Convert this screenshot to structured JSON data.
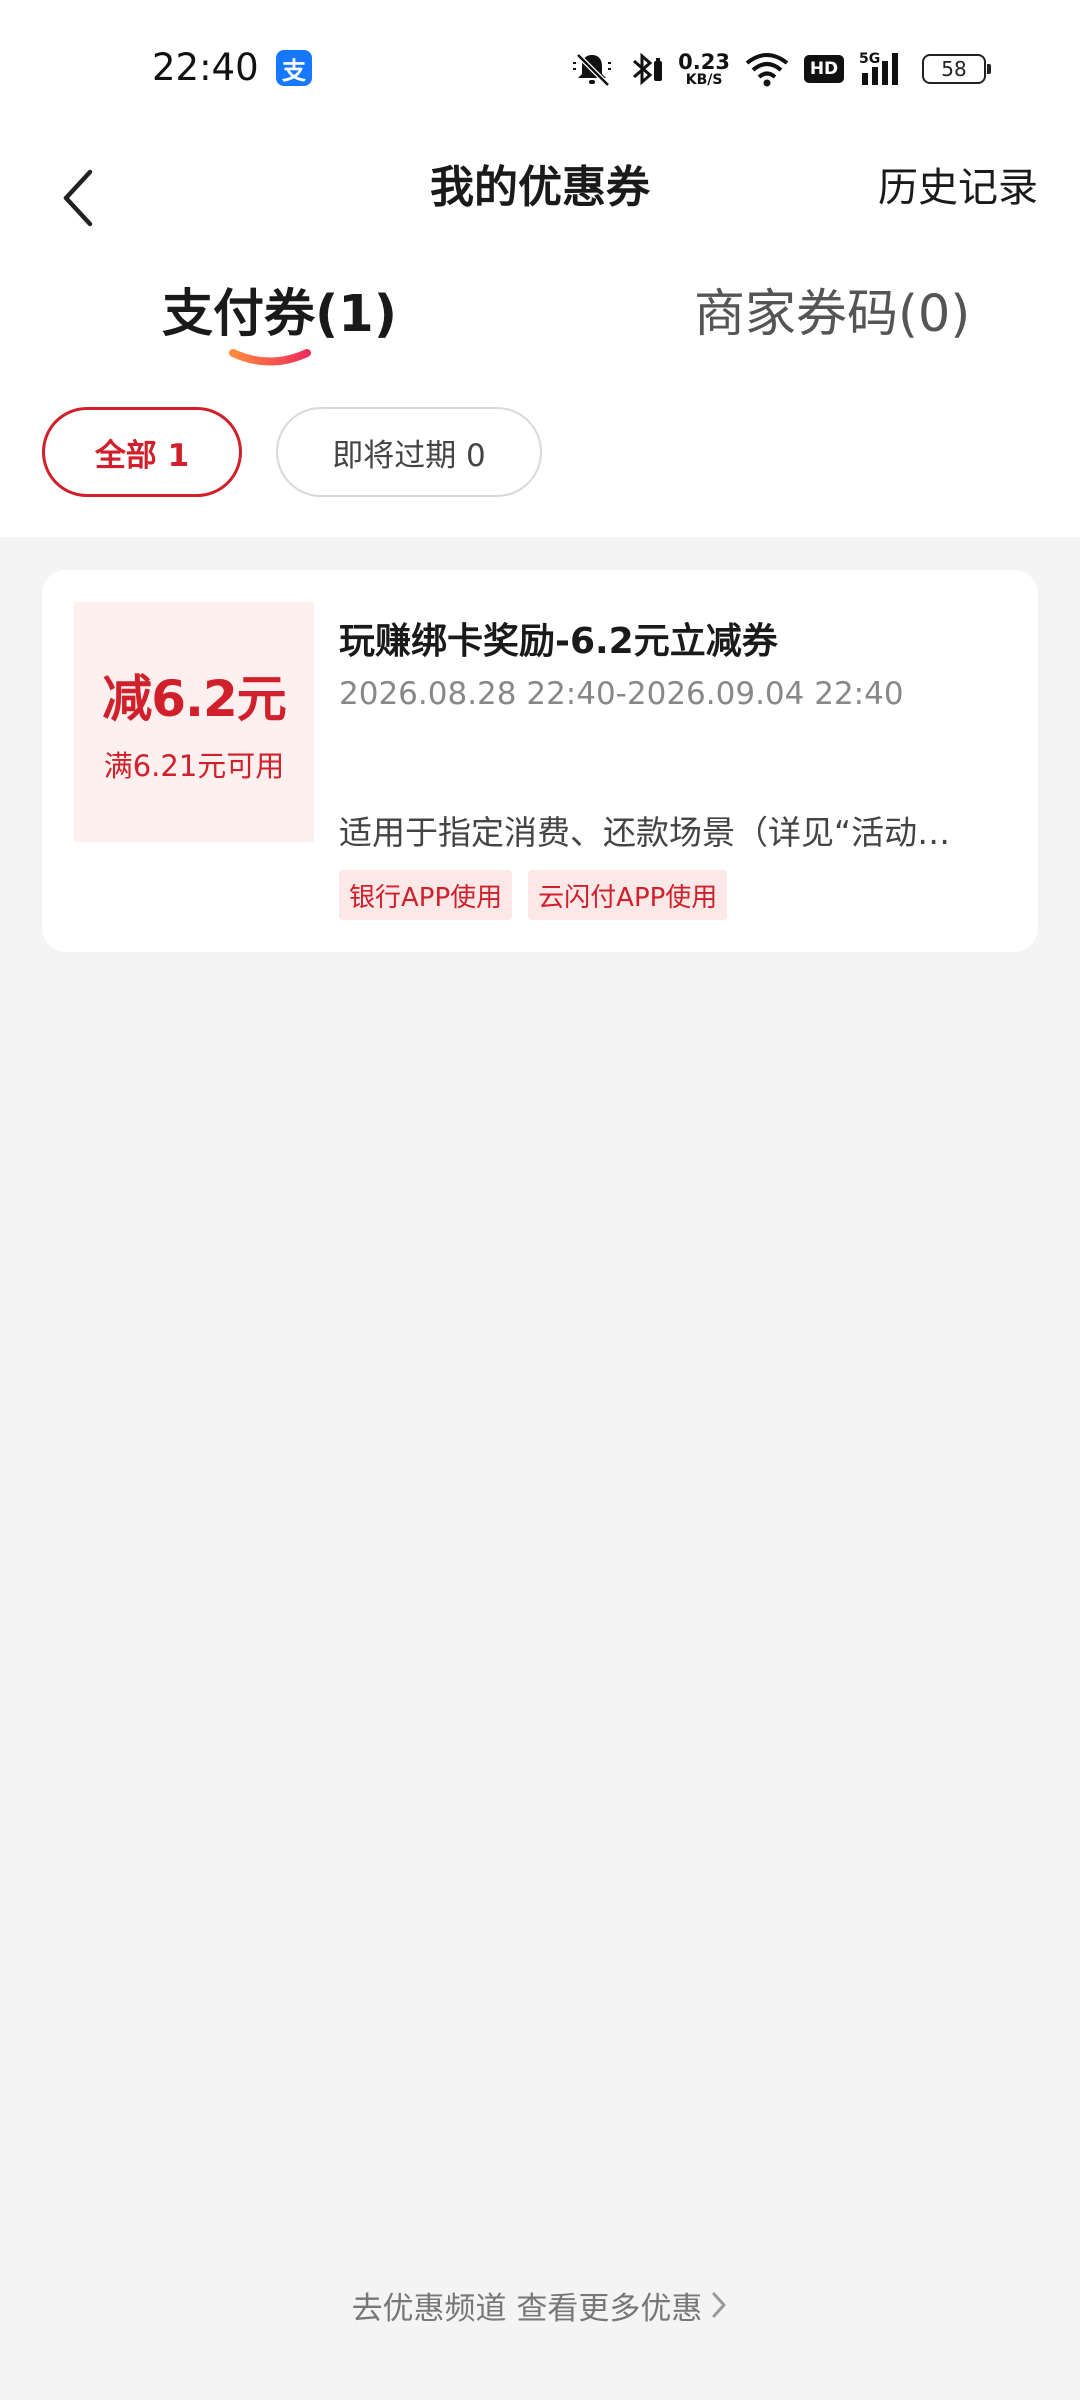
{
  "status_bar": {
    "time": "22:40",
    "app_icon": "alipay-icon",
    "app_glyph": "支",
    "net_speed_value": "0.23",
    "net_speed_unit": "KB/S",
    "hd_label": "HD",
    "signal_label": "5G",
    "battery": "58"
  },
  "nav": {
    "title": "我的优惠券",
    "history_label": "历史记录"
  },
  "tabs": [
    {
      "label": "支付券(1)",
      "active": true
    },
    {
      "label": "商家券码(0)",
      "active": false
    }
  ],
  "filters": [
    {
      "label": "全部 1",
      "active": true
    },
    {
      "label": "即将过期 0",
      "active": false
    }
  ],
  "coupon": {
    "amount": "减6.2元",
    "condition": "满6.21元可用",
    "title": "玩赚绑卡奖励-6.2元立减券",
    "period": "2026.08.28 22:40-2026.09.04 22:40",
    "description": "适用于指定消费、还款场景（详见“活动细则”）",
    "tags": [
      "银行APP使用",
      "云闪付APP使用"
    ]
  },
  "footer": {
    "link_label": "去优惠频道 查看更多优惠"
  },
  "colors": {
    "accent": "#d0202b",
    "tag_bg": "#fde8e8",
    "amount_bg": "#fff0f0",
    "page_bg": "#f4f4f4"
  }
}
